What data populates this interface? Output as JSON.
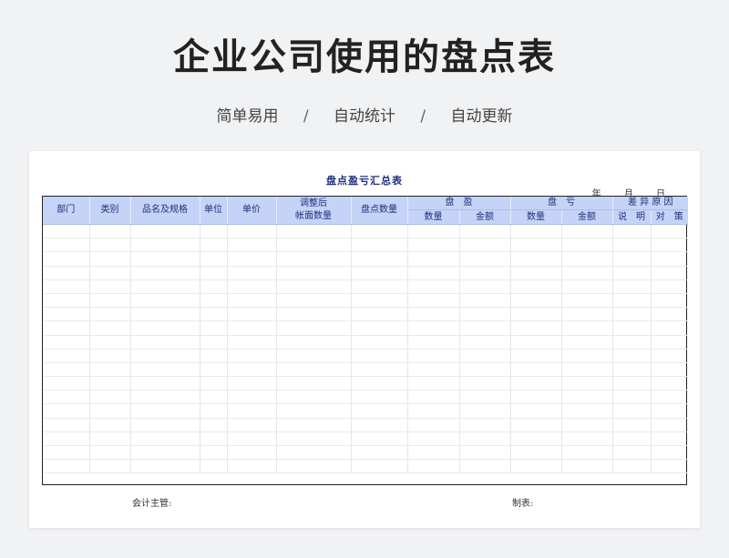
{
  "page": {
    "title": "企业公司使用的盘点表",
    "features": [
      "简单易用",
      "自动统计",
      "自动更新"
    ],
    "separator": "/"
  },
  "sheet": {
    "title": "盘点盈亏汇总表",
    "date": {
      "year": "年",
      "month": "月",
      "day": "日"
    },
    "headers": {
      "dept": "部门",
      "category": "类别",
      "name_spec": "品名及规格",
      "unit": "单位",
      "unit_price": "单价",
      "adjusted_line1": "调整后",
      "adjusted_line2": "帐面数量",
      "count_qty": "盘点数量",
      "surplus": "盘　盈",
      "deficit": "盘　亏",
      "reason": "差 异 原 因",
      "surplus_qty": "数量",
      "surplus_amount": "金额",
      "deficit_qty": "数量",
      "deficit_amount": "金额",
      "explain": "说　明",
      "countermeasure": "对　策"
    },
    "footer": {
      "supervisor": "会计主管:",
      "preparer": "制表:"
    }
  }
}
